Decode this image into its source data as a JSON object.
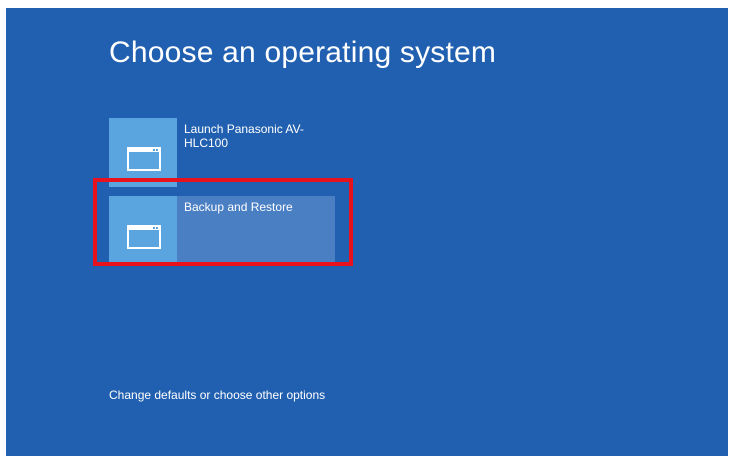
{
  "page": {
    "title": "Choose an operating system"
  },
  "os_list": [
    {
      "label": "Launch Panasonic AV-HLC100",
      "icon": "window-icon"
    },
    {
      "label": "Backup and Restore",
      "icon": "window-icon",
      "selected": true
    }
  ],
  "footer": {
    "options_link": "Change defaults or choose other options"
  },
  "colors": {
    "background": "#2160b0",
    "tile": "#5aa4df",
    "selected_item": "#4a7fc4",
    "highlight_border": "#e8121d",
    "text": "#ffffff"
  }
}
